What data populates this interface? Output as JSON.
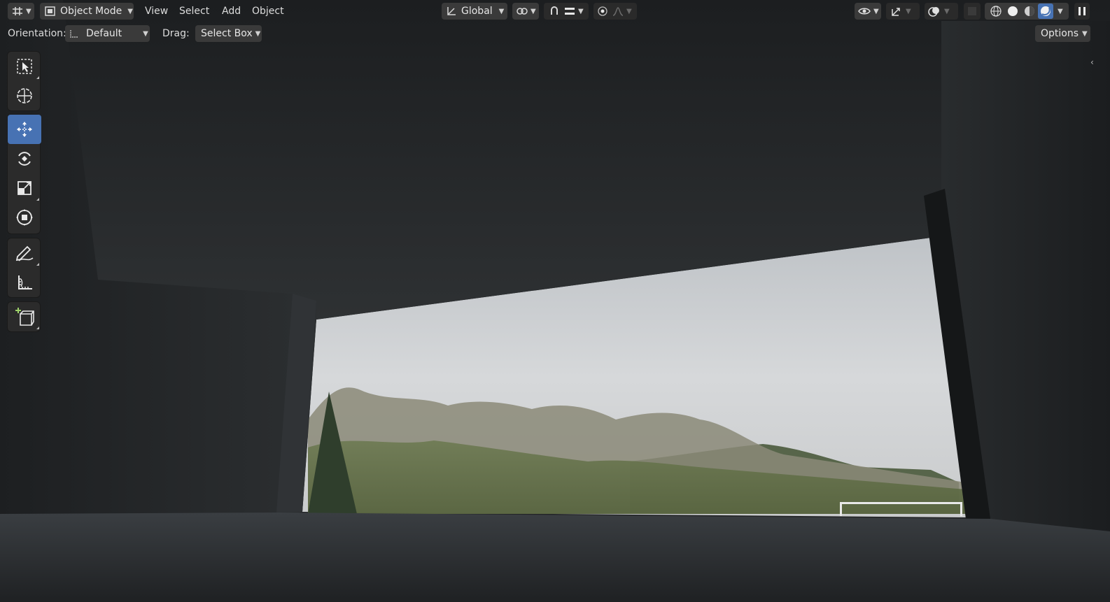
{
  "header": {
    "editor_type_icon": "viewport-editor-icon",
    "mode": {
      "label": "Object Mode",
      "icon": "object-mode-icon"
    },
    "menus": [
      "View",
      "Select",
      "Add",
      "Object"
    ],
    "transform_orientation": {
      "label": "Global",
      "icon": "transform-axes-icon"
    },
    "pivot_icon": "pivot-link-icon",
    "snap_icon": "snap-magnet-icon",
    "snap_target_icon": "snap-increment-icon",
    "proportional_icon": "proportional-edit-icon",
    "falloff_icon": "falloff-curve-icon",
    "visibility_icon": "eye-visibility-icon",
    "gizmo_icon": "gizmo-icon",
    "overlay_icon": "overlay-icon",
    "xray_icon": "xray-icon",
    "shading": {
      "wireframe_icon": "wireframe-sphere-icon",
      "solid_icon": "solid-sphere-icon",
      "material_icon": "material-sphere-icon",
      "rendered_icon": "rendered-sphere-icon",
      "active": "rendered"
    },
    "pause_icon": "pause-icon"
  },
  "subheader": {
    "orientation_label": "Orientation:",
    "orientation_value": "Default",
    "drag_label": "Drag:",
    "drag_value": "Select Box",
    "options_label": "Options"
  },
  "toolbar": {
    "tools": [
      {
        "name": "select-box-tool",
        "icon": "select-box-icon",
        "active": false
      },
      {
        "name": "cursor-tool",
        "icon": "cursor-icon",
        "active": false
      },
      {
        "name": "move-tool",
        "icon": "move-icon",
        "active": true
      },
      {
        "name": "rotate-tool",
        "icon": "rotate-icon",
        "active": false
      },
      {
        "name": "scale-tool",
        "icon": "scale-icon",
        "active": false
      },
      {
        "name": "transform-tool",
        "icon": "transform-icon",
        "active": false
      },
      {
        "name": "annotate-tool",
        "icon": "annotate-icon",
        "active": false
      },
      {
        "name": "measure-tool",
        "icon": "measure-icon",
        "active": false
      },
      {
        "name": "add-cube-tool",
        "icon": "add-cube-icon",
        "active": false
      }
    ]
  },
  "colors": {
    "accent": "#4772b3",
    "header_bg": "#1d1d1d",
    "button_bg": "#3a3a3a",
    "concrete": "#2a2c2e",
    "sky": "#cfd2d5"
  }
}
